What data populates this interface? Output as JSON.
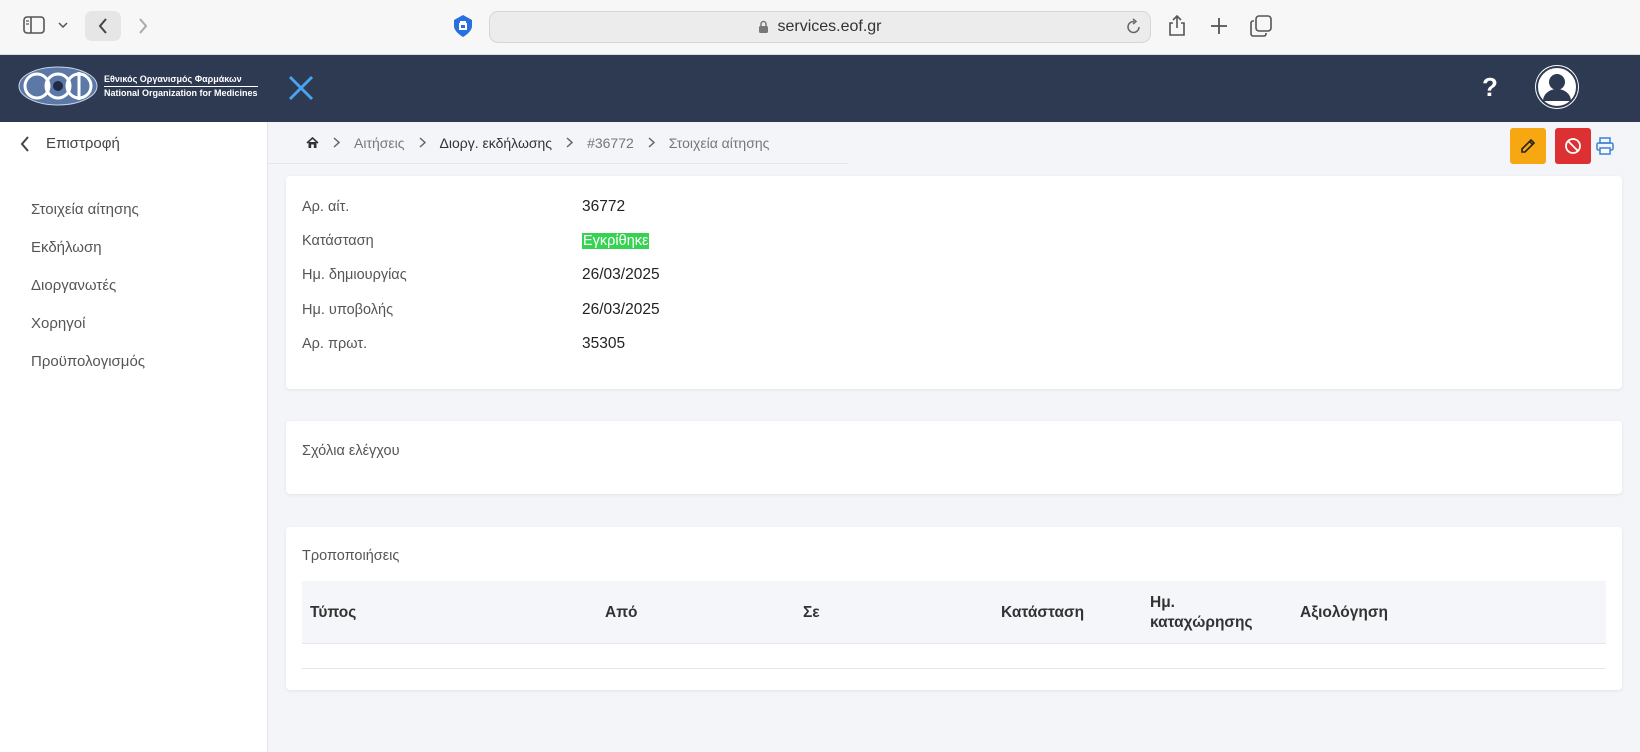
{
  "browser": {
    "url": "services.eof.gr"
  },
  "header": {
    "logo_line1": "Εθνικός Οργανισμός Φαρμάκων",
    "logo_line2": "National Organization for Medicines",
    "help_label": "?"
  },
  "sidebar": {
    "back_label": "Επιστροφή",
    "items": [
      {
        "label": "Στοιχεία αίτησης"
      },
      {
        "label": "Εκδήλωση"
      },
      {
        "label": "Διοργανωτές"
      },
      {
        "label": "Χορηγοί"
      },
      {
        "label": "Προϋπολογισμός"
      }
    ]
  },
  "breadcrumb": {
    "items": [
      "Αιτήσεις",
      "Διοργ. εκδήλωσης",
      "#36772",
      "Στοιχεία αίτησης"
    ]
  },
  "details": {
    "rows": [
      {
        "label": "Αρ. αίτ.",
        "value": "36772"
      },
      {
        "label": "Κατάσταση",
        "value": "Εγκρίθηκε"
      },
      {
        "label": "Ημ. δημιουργίας",
        "value": "26/03/2025"
      },
      {
        "label": "Ημ. υποβολής",
        "value": "26/03/2025"
      },
      {
        "label": "Αρ. πρωτ.",
        "value": "35305"
      }
    ]
  },
  "comments": {
    "title": "Σχόλια ελέγχου"
  },
  "modifications": {
    "title": "Τροποποιήσεις",
    "columns": [
      {
        "label": "Τύπος"
      },
      {
        "label": "Από"
      },
      {
        "label": "Σε"
      },
      {
        "label": "Κατάσταση"
      },
      {
        "label": "Ημ. καταχώρησης"
      },
      {
        "label": "Αξιολόγηση"
      }
    ]
  },
  "colors": {
    "header_bg": "#2e3a52",
    "status_approved": "#36d352",
    "edit_button": "#f7a711",
    "cancel_button": "#dc3032"
  }
}
